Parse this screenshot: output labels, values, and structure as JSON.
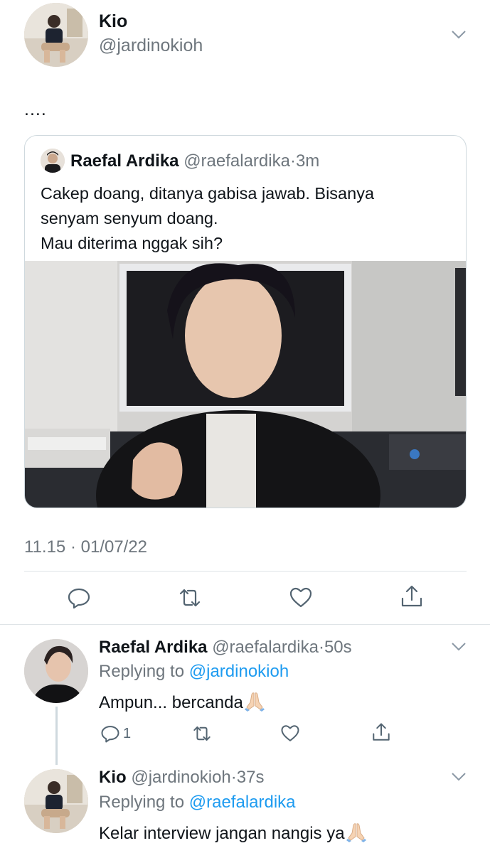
{
  "tweet": {
    "author_name": "Kio",
    "author_handle": "@jardinokioh",
    "text": "....",
    "timestamp": "11.15 · 01/07/22",
    "quote": {
      "author_name": "Raefal Ardika",
      "author_handle": "@raefalardika",
      "time": "3m",
      "text": "Cakep doang, ditanya gabisa jawab. Bisanya\nsenyam senyum doang.\nMau diterima nggak sih?"
    },
    "actions": [
      "reply-icon",
      "retweet-icon",
      "like-icon",
      "share-icon"
    ]
  },
  "replies": [
    {
      "author_name": "Raefal Ardika",
      "author_handle": "@raefalardika",
      "time": "50s",
      "replying_label": "Replying to",
      "replying_to": "@jardinokioh",
      "text": "Ampun... bercanda",
      "emoji": "folded-hands-emoji",
      "reply_count": "1"
    },
    {
      "author_name": "Kio",
      "author_handle": "@jardinokioh",
      "time": "37s",
      "replying_label": "Replying to",
      "replying_to": "@raefalardika",
      "text": "Kelar interview jangan nangis ya",
      "emoji": "folded-hands-emoji"
    }
  ],
  "colors": {
    "link": "#1d9bf0",
    "muted": "#6e767d",
    "border": "#cfd9de",
    "icon": "#536471"
  }
}
